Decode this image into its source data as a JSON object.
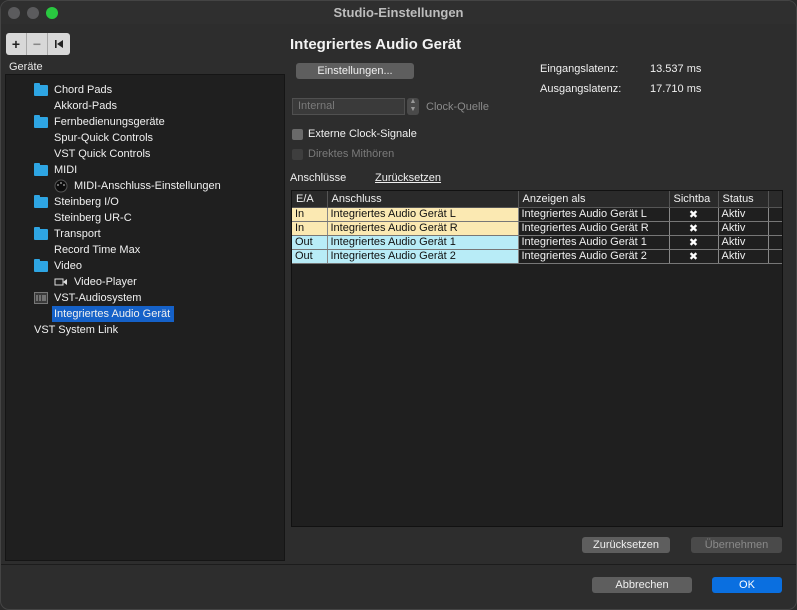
{
  "window": {
    "title": "Studio-Einstellungen"
  },
  "toolbar": {
    "add": "+",
    "remove": "−",
    "reset": "⏮"
  },
  "devices": {
    "label": "Geräte",
    "items": [
      {
        "label": "Chord Pads",
        "icon": "folder-icon"
      },
      {
        "label": "Akkord-Pads",
        "icon": ""
      },
      {
        "label": "Fernbedienungsgeräte",
        "icon": "folder-icon"
      },
      {
        "label": "Spur-Quick Controls",
        "icon": ""
      },
      {
        "label": "VST Quick Controls",
        "icon": ""
      },
      {
        "label": "MIDI",
        "icon": "folder-icon"
      },
      {
        "label": "MIDI-Anschluss-Einstellungen",
        "icon": "midi-port-icon"
      },
      {
        "label": "Steinberg I/O",
        "icon": "folder-icon"
      },
      {
        "label": "Steinberg UR-C",
        "icon": ""
      },
      {
        "label": "Transport",
        "icon": "folder-icon"
      },
      {
        "label": "Record Time Max",
        "icon": ""
      },
      {
        "label": "Video",
        "icon": "folder-icon"
      },
      {
        "label": "Video-Player",
        "icon": "video-icon"
      },
      {
        "label": "VST-Audiosystem",
        "icon": "audio-system-icon"
      },
      {
        "label": "Integriertes Audio Gerät",
        "icon": ""
      },
      {
        "label": "VST System Link",
        "icon": ""
      }
    ]
  },
  "main": {
    "heading": "Integriertes Audio Gerät",
    "settings_button": "Einstellungen...",
    "input_latency_label": "Eingangslatenz:",
    "input_latency_value": "13.537 ms",
    "output_latency_label": "Ausgangslatenz:",
    "output_latency_value": "17.710 ms",
    "clock_source_value": "Internal",
    "clock_source_label": "Clock-Quelle",
    "external_clock_label": "Externe Clock-Signale",
    "direct_monitoring_label": "Direktes Mithören",
    "tab_ports": "Anschlüsse",
    "tab_reset": "Zurücksetzen",
    "table": {
      "headers": [
        "E/A",
        "Anschluss",
        "Anzeigen als",
        "Sichtba",
        "Status"
      ],
      "rows": [
        {
          "io": "In",
          "port": "Integriertes Audio Gerät L",
          "display": "Integriertes Audio Gerät L",
          "visible": "✖",
          "status": "Aktiv"
        },
        {
          "io": "In",
          "port": "Integriertes Audio Gerät R",
          "display": "Integriertes Audio Gerät R",
          "visible": "✖",
          "status": "Aktiv"
        },
        {
          "io": "Out",
          "port": "Integriertes Audio Gerät 1",
          "display": "Integriertes Audio Gerät 1",
          "visible": "✖",
          "status": "Aktiv"
        },
        {
          "io": "Out",
          "port": "Integriertes Audio Gerät 2",
          "display": "Integriertes Audio Gerät 2",
          "visible": "✖",
          "status": "Aktiv"
        }
      ]
    },
    "reset_button": "Zurücksetzen",
    "apply_button": "Übernehmen"
  },
  "footer": {
    "cancel": "Abbrechen",
    "ok": "OK"
  },
  "colors": {
    "accent": "#0a6fe0",
    "selection": "#1561c8",
    "folder": "#2ea5e3",
    "in_row": "#fbe9b2",
    "out_row": "#b8ecf7"
  }
}
